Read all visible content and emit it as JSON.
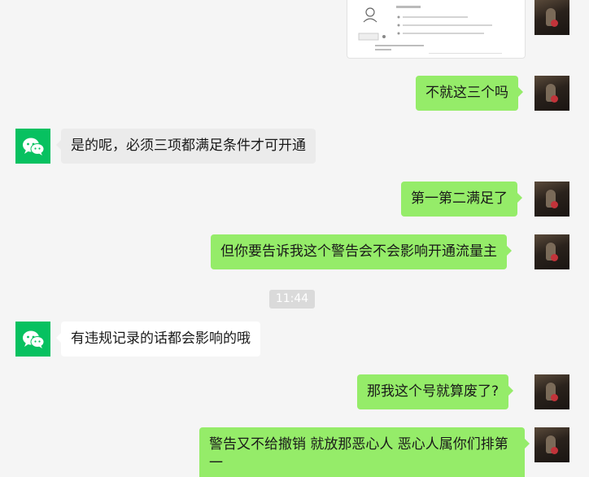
{
  "messages": [
    {
      "id": "m1",
      "text": "不就这三个吗"
    },
    {
      "id": "m2",
      "text": "是的呢，必须三项都满足条件才可开通"
    },
    {
      "id": "m3",
      "text": "第一第二满足了"
    },
    {
      "id": "m4",
      "text": "但你要告诉我这个警告会不会影响开通流量主"
    },
    {
      "id": "m5",
      "text": "有违规记录的话都会影响的哦"
    },
    {
      "id": "m6",
      "text": "那我这个号就算废了?"
    },
    {
      "id": "m7",
      "text": "警告又不给撤销 就放那恶心人  恶心人属你们排第一"
    }
  ],
  "timestamp": "11:44",
  "colors": {
    "background": "#f5f5f5",
    "outgoing_bubble": "#95ec69",
    "incoming_bubble_gray": "#ebebeb",
    "incoming_bubble_white": "#ffffff",
    "wechat_green": "#07c160"
  },
  "icons": {
    "bot_avatar": "wechat-logo-icon",
    "user_avatar": "user-photo-avatar"
  }
}
